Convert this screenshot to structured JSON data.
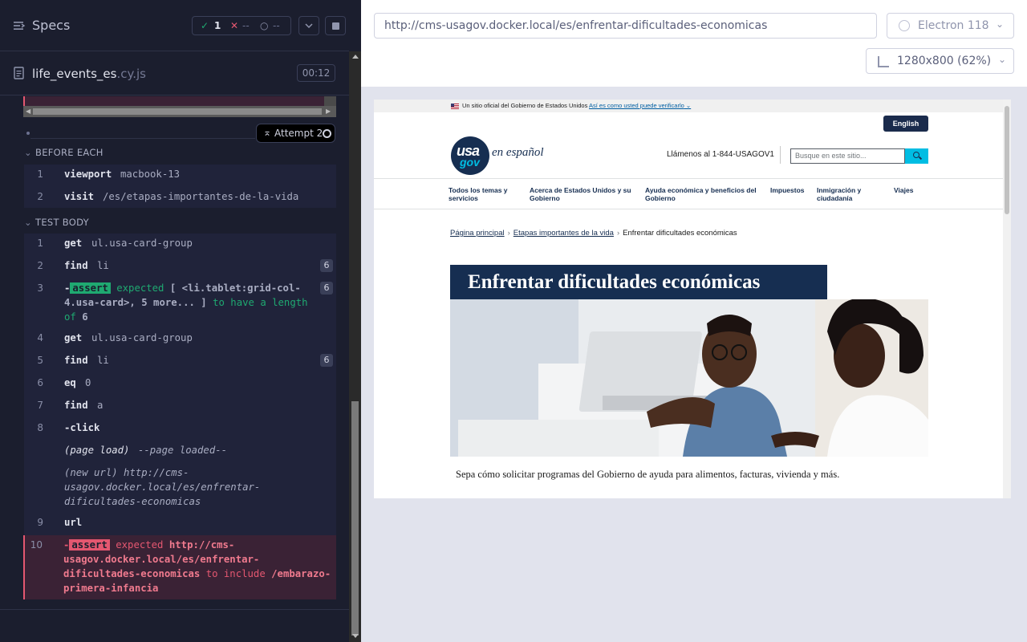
{
  "reporter": {
    "header": {
      "title": "Specs",
      "passed": "1",
      "failed": "--",
      "pending": "--"
    },
    "spec": {
      "name": "life_events_es",
      "ext": ".cy.js",
      "duration": "00:12"
    },
    "attempt_label": "Attempt 2",
    "before_each": {
      "title": "BEFORE EACH",
      "commands": [
        {
          "num": "1",
          "name": "viewport",
          "msg": "macbook-13"
        },
        {
          "num": "2",
          "name": "visit",
          "msg": "/es/etapas-importantes-de-la-vida"
        }
      ]
    },
    "test_body": {
      "title": "TEST BODY",
      "commands": [
        {
          "num": "1",
          "name": "get",
          "msg": "ul.usa-card-group"
        },
        {
          "num": "2",
          "name": "find",
          "msg": "li",
          "badge": "6"
        },
        {
          "num": "3",
          "prefix": "-",
          "pill": "assert",
          "expected": "expected",
          "msg": "[ <li.tablet:grid-col-4.usa-card>, 5 more... ]",
          "to_have": "to have a length of",
          "value": "6",
          "badge": "6"
        },
        {
          "num": "4",
          "name": "get",
          "msg": "ul.usa-card-group"
        },
        {
          "num": "5",
          "name": "find",
          "msg": "li",
          "badge": "6"
        },
        {
          "num": "6",
          "name": "eq",
          "msg": "0"
        },
        {
          "num": "7",
          "name": "find",
          "msg": "a"
        },
        {
          "num": "8",
          "name": "-click",
          "msg": ""
        },
        {
          "num": "",
          "name": "(page load)",
          "msg": "--page loaded--"
        },
        {
          "num": "",
          "name": "(new url)",
          "msg": "http://cms-usagov.docker.local/es/enfrentar-dificultades-economicas"
        },
        {
          "num": "9",
          "name": "url",
          "msg": ""
        },
        {
          "num": "10",
          "prefix": "-",
          "pill": "assert",
          "expected": "expected",
          "msg": "http://cms-usagov.docker.local/es/enfrentar-dificultades-economicas",
          "to_include": "to include",
          "value": "/embarazo-primera-infancia"
        }
      ]
    }
  },
  "aut": {
    "url": "http://cms-usagov.docker.local/es/enfrentar-dificultades-economicas",
    "browser": "Electron 118",
    "viewport": "1280x800 (62%)"
  },
  "page": {
    "banner_text": "Un sitio oficial del Gobierno de Estados Unidos",
    "banner_link": "Así es como usted puede verificarlo",
    "english_button": "English",
    "logo_usa": "usa",
    "logo_gov": "gov",
    "logo_es": "en español",
    "phone": "Llámenos al 1-844-USAGOV1",
    "search_placeholder": "Busque en este sitio...",
    "nav": [
      "Todos los temas y servicios",
      "Acerca de Estados Unidos y su Gobierno",
      "Ayuda económica y beneficios del Gobierno",
      "Impuestos",
      "Inmigración y ciudadanía",
      "Viajes"
    ],
    "breadcrumb": [
      "Página principal",
      "Etapas importantes de la vida",
      "Enfrentar dificultades económicas"
    ],
    "title": "Enfrentar dificultades económicas",
    "intro": "Sepa cómo solicitar programas del Gobierno de ayuda para alimentos, facturas, vivienda y más."
  },
  "colors": {
    "reporter_bg": "#1b1e2e",
    "pass": "#1fa971",
    "fail": "#e45770",
    "gov_navy": "#162e51",
    "gov_cyan": "#00bde3"
  }
}
